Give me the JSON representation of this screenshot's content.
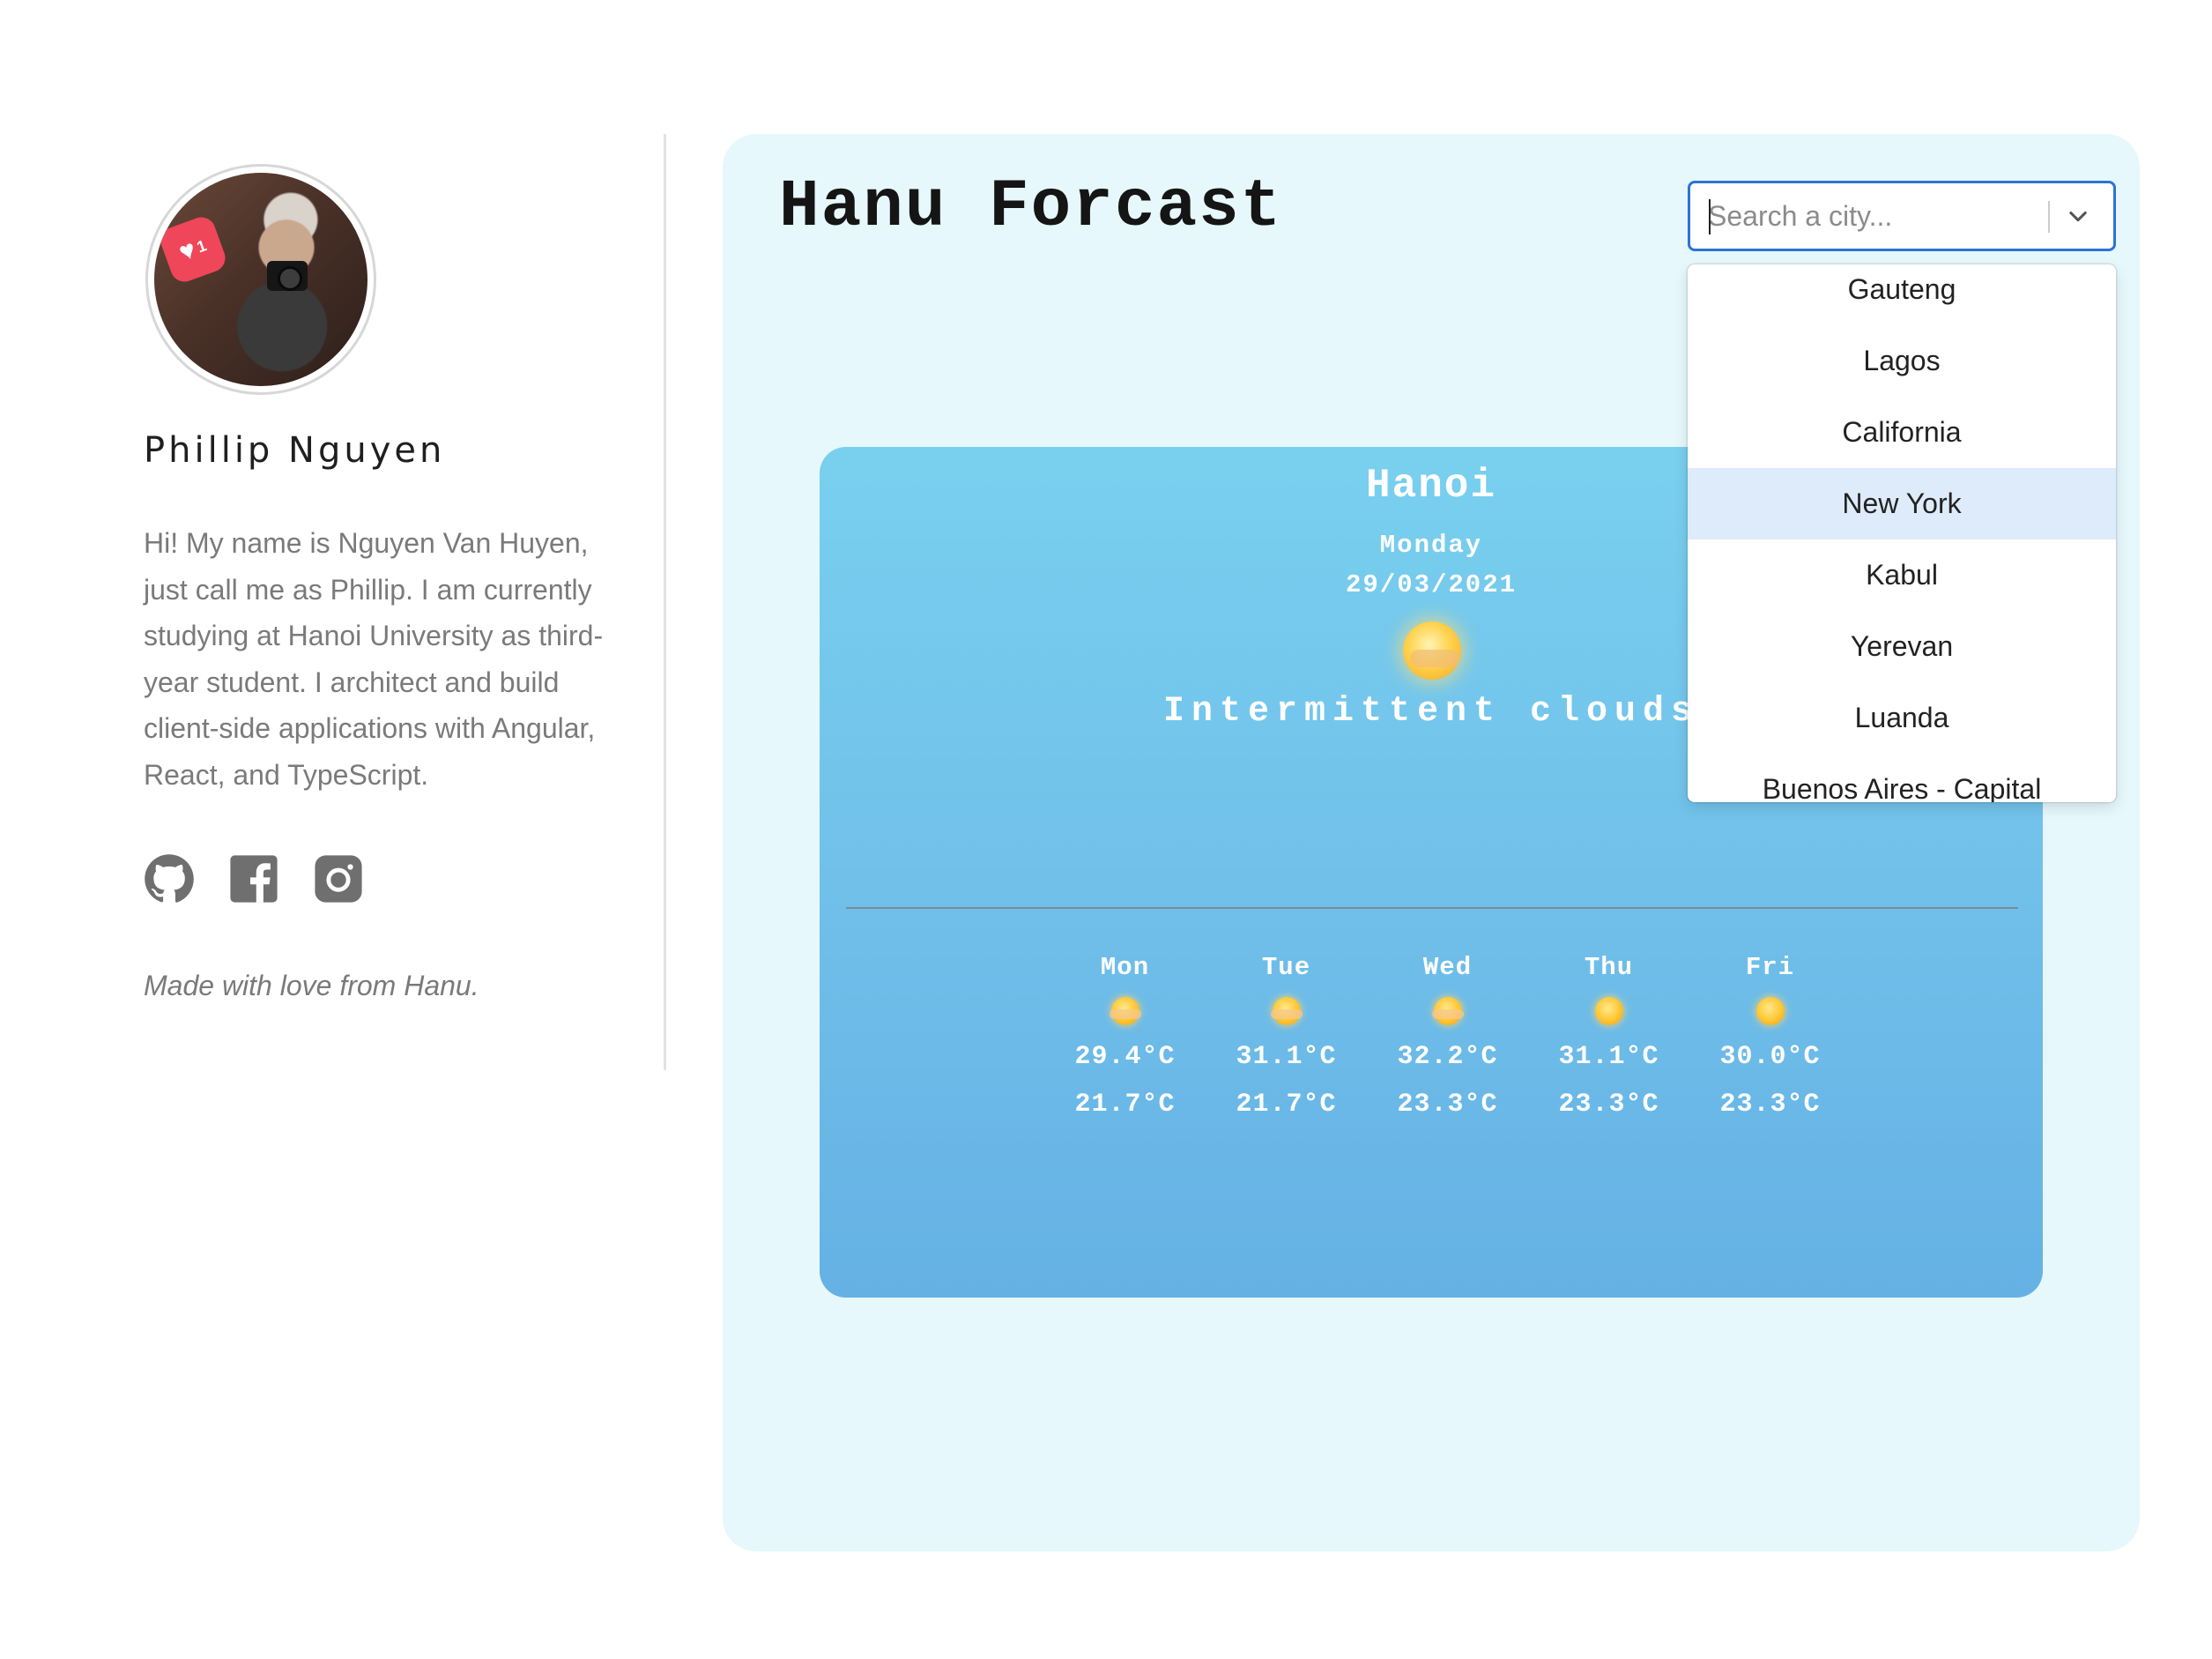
{
  "profile": {
    "name": "Phillip Nguyen",
    "bio": "Hi! My name is Nguyen Van Huyen, just call me as Phillip. I am currently studying at Hanoi University as third-year student. I architect and build client-side applications with Angular, React, and TypeScript.",
    "like_badge": "1",
    "socials": [
      {
        "icon": "github-icon"
      },
      {
        "icon": "facebook-icon"
      },
      {
        "icon": "instagram-icon"
      }
    ],
    "footer": "Made with love from Hanu."
  },
  "app": {
    "title": "Hanu Forcast"
  },
  "search": {
    "placeholder": "Search a city...",
    "options": [
      "Gauteng",
      "Lagos",
      "California",
      "New York",
      "Kabul",
      "Yerevan",
      "Luanda",
      "Buenos Aires - Capital"
    ],
    "highlighted": "New York"
  },
  "current": {
    "city": "Hanoi",
    "day": "Monday",
    "date": "29/03/2021",
    "condition": "Intermittent clouds",
    "icon": "partly-sunny-icon"
  },
  "forecast": [
    {
      "day": "Mon",
      "max": "29.4°C",
      "min": "21.7°C",
      "icon": "partly-sunny-icon"
    },
    {
      "day": "Tue",
      "max": "31.1°C",
      "min": "21.7°C",
      "icon": "partly-sunny-icon"
    },
    {
      "day": "Wed",
      "max": "32.2°C",
      "min": "23.3°C",
      "icon": "partly-sunny-icon"
    },
    {
      "day": "Thu",
      "max": "31.1°C",
      "min": "23.3°C",
      "icon": "sunny-icon"
    },
    {
      "day": "Fri",
      "max": "30.0°C",
      "min": "23.3°C",
      "icon": "sunny-icon"
    }
  ],
  "colors": {
    "panel_bg": "#e6f8fc",
    "card_top": "#78d0ee",
    "card_bottom": "#65b1e4",
    "select_border": "#2d73d6",
    "option_highlight": "#deebfb"
  }
}
